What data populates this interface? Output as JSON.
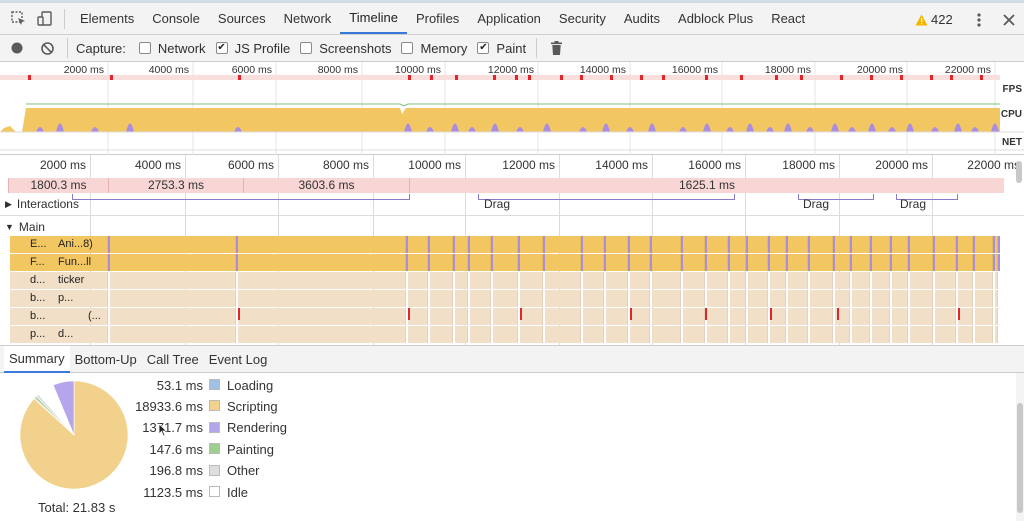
{
  "tabs": [
    {
      "label": "Elements"
    },
    {
      "label": "Console"
    },
    {
      "label": "Sources"
    },
    {
      "label": "Network"
    },
    {
      "label": "Timeline"
    },
    {
      "label": "Profiles"
    },
    {
      "label": "Application"
    },
    {
      "label": "Security"
    },
    {
      "label": "Audits"
    },
    {
      "label": "Adblock Plus"
    },
    {
      "label": "React"
    }
  ],
  "active_tab": "Timeline",
  "warnings": {
    "count": "422",
    "icon": "warning-triangle-icon",
    "color": "#f4b400"
  },
  "toolbar": {
    "capture_label": "Capture:",
    "options": [
      {
        "label": "Network",
        "checked": false
      },
      {
        "label": "JS Profile",
        "checked": true
      },
      {
        "label": "Screenshots",
        "checked": false
      },
      {
        "label": "Memory",
        "checked": false
      },
      {
        "label": "Paint",
        "checked": true
      }
    ]
  },
  "overview": {
    "ticks": [
      "2000 ms",
      "4000 ms",
      "6000 ms",
      "8000 ms",
      "10000 ms",
      "12000 ms",
      "14000 ms",
      "16000 ms",
      "18000 ms",
      "20000 ms",
      "22000 ms"
    ],
    "labels": {
      "fps": "FPS",
      "cpu": "CPU",
      "net": "NET"
    }
  },
  "flamechart": {
    "ticks": [
      "2000 ms",
      "4000 ms",
      "6000 ms",
      "8000 ms",
      "10000 ms",
      "12000 ms",
      "14000 ms",
      "16000 ms",
      "18000 ms",
      "20000 ms",
      "22000 ms"
    ],
    "frames": [
      "1800.3 ms",
      "2753.3 ms",
      "3603.6 ms",
      "1625.1 ms"
    ],
    "interactions_label": "Interactions",
    "drag_labels": [
      "Drag",
      "Drag",
      "Drag"
    ],
    "main_label": "Main",
    "rows": [
      {
        "a": "E...",
        "b": "Ani...8)"
      },
      {
        "a": "F...",
        "b": "Fun...ll"
      },
      {
        "a": "d...",
        "b": "ticker"
      },
      {
        "a": "b...",
        "b": "p..."
      },
      {
        "a": "b...",
        "b": "(..."
      },
      {
        "a": "p...",
        "b": "d..."
      }
    ]
  },
  "bottom_tabs": [
    "Summary",
    "Bottom-Up",
    "Call Tree",
    "Event Log"
  ],
  "summary": {
    "total_label": "Total: 21.83 s",
    "items": [
      {
        "value": "53.1 ms",
        "name": "Loading",
        "color": "#a1c0e6"
      },
      {
        "value": "18933.6 ms",
        "name": "Scripting",
        "color": "#f2d18d"
      },
      {
        "value": "1371.7 ms",
        "name": "Rendering",
        "color": "#b5a5eb"
      },
      {
        "value": "147.6 ms",
        "name": "Painting",
        "color": "#9fcf8f"
      },
      {
        "value": "196.8 ms",
        "name": "Other",
        "color": "#dedede"
      },
      {
        "value": "1123.5 ms",
        "name": "Idle",
        "color": "#ffffff"
      }
    ]
  },
  "colors": {
    "scripting": "#f2c761",
    "rendering": "#a98ee0",
    "frame": "#f7d6d5",
    "accent": "#3879d9"
  }
}
